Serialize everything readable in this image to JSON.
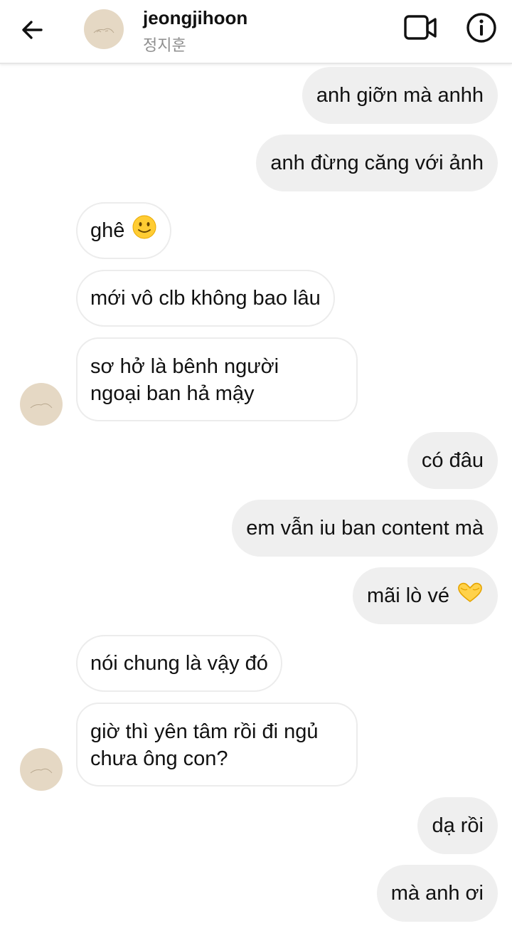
{
  "header": {
    "username": "jeongjihoon",
    "display_name": "정지훈"
  },
  "messages": [
    {
      "side": "out",
      "text": "anh giỡn mà anhh"
    },
    {
      "side": "out",
      "text": "anh đừng căng với ảnh"
    },
    {
      "side": "in",
      "text": "ghê",
      "emoji": "slightly-smiling-face"
    },
    {
      "side": "in",
      "text": "mới vô clb không bao lâu"
    },
    {
      "side": "in",
      "line1": "sơ hở là bênh người",
      "line2": "ngoại ban hả mậy"
    },
    {
      "side": "out",
      "text": "có đâu"
    },
    {
      "side": "out",
      "text": "em vẫn iu ban content mà"
    },
    {
      "side": "out",
      "text": "mãi lò vé",
      "emoji": "heart-hands"
    },
    {
      "side": "in",
      "text": "nói chung là vậy đó"
    },
    {
      "side": "in",
      "line1": "giờ thì yên tâm rồi đi ngủ",
      "line2": "chưa ông con?"
    },
    {
      "side": "out",
      "text": "dạ rồi"
    },
    {
      "side": "out",
      "text": "mà anh ơi"
    }
  ],
  "icons": {
    "back": "arrow-left-icon",
    "video": "video-call-icon",
    "info": "info-icon"
  },
  "colors": {
    "outgoing_bubble": "#efefef",
    "incoming_border": "#ececec",
    "avatar_bg": "#e5d8c4",
    "subtitle": "#8e8e8e"
  }
}
